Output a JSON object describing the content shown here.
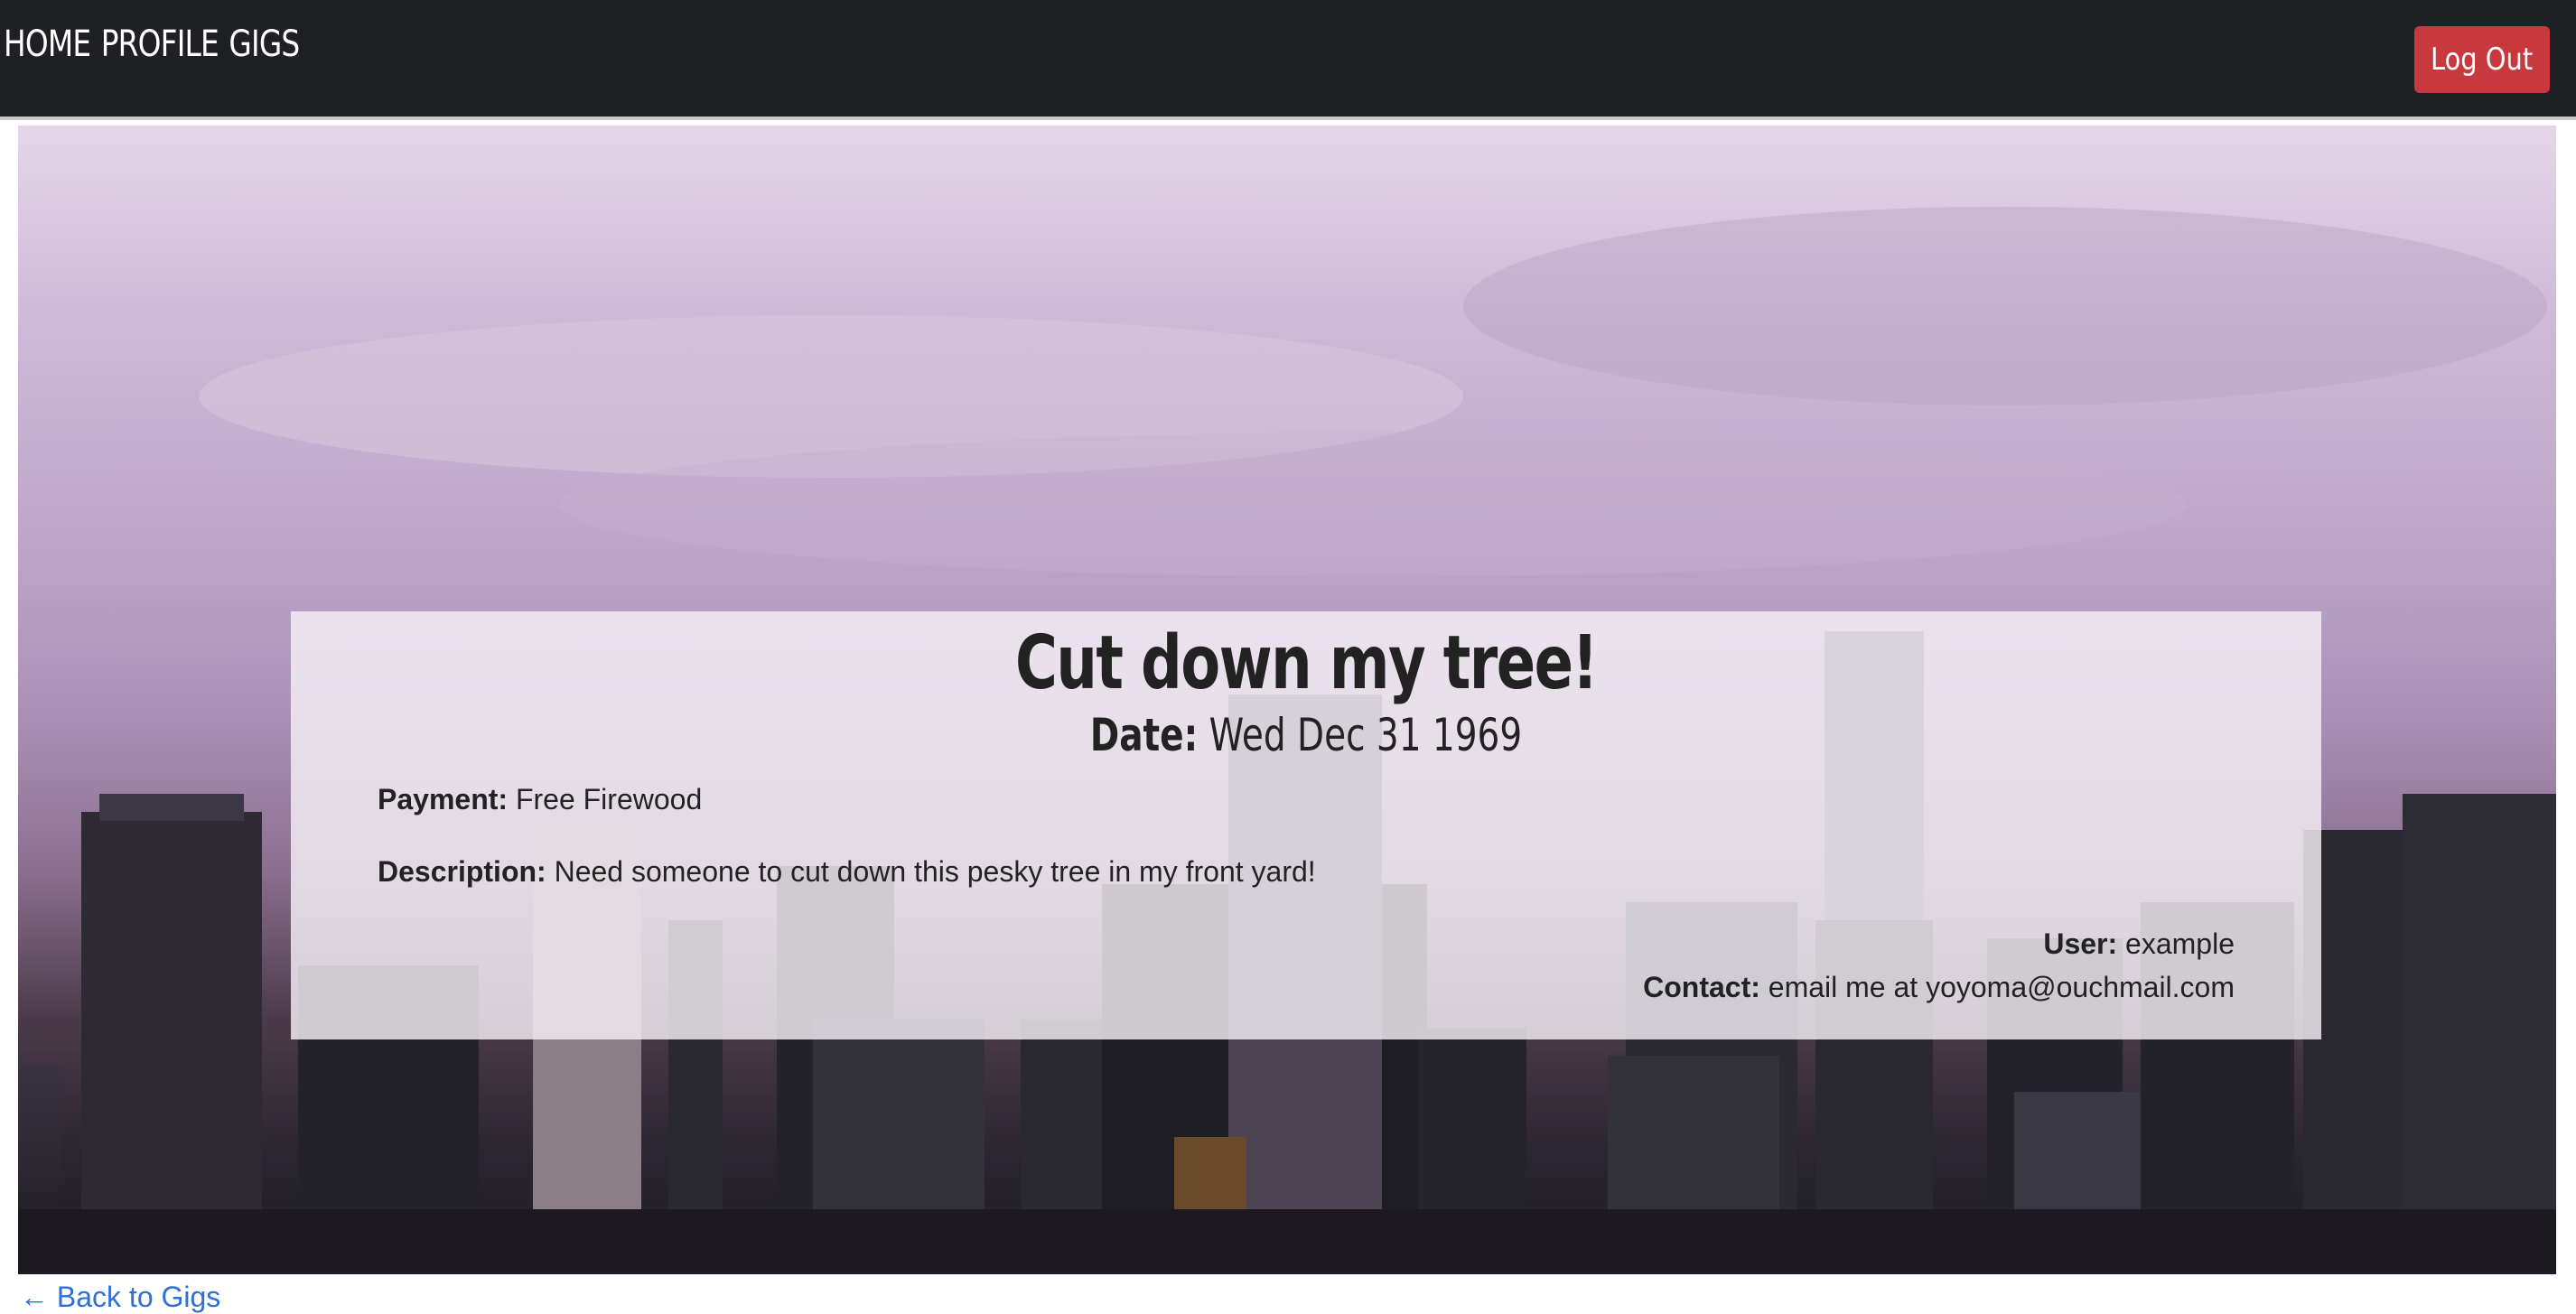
{
  "navbar": {
    "links": [
      "HOME",
      "PROFILE",
      "GIGS"
    ],
    "logout_label": "Log Out",
    "background": "#1f2024",
    "logout_color": "#c8393f"
  },
  "gig": {
    "title": "Cut down my tree!",
    "date_label": "Date:",
    "date_value": "Wed Dec 31 1969",
    "payment_label": "Payment:",
    "payment_value": "Free Firewood",
    "description_label": "Description:",
    "description_value": "Need someone to cut down this pesky tree in my front yard!",
    "user_label": "User:",
    "user_value": "example",
    "contact_label": "Contact:",
    "contact_value": "email me at yoyoma@ouchmail.com"
  },
  "back_link": "← Back to Gigs",
  "colors": {
    "link": "#2f6fd6",
    "text": "#222222"
  }
}
